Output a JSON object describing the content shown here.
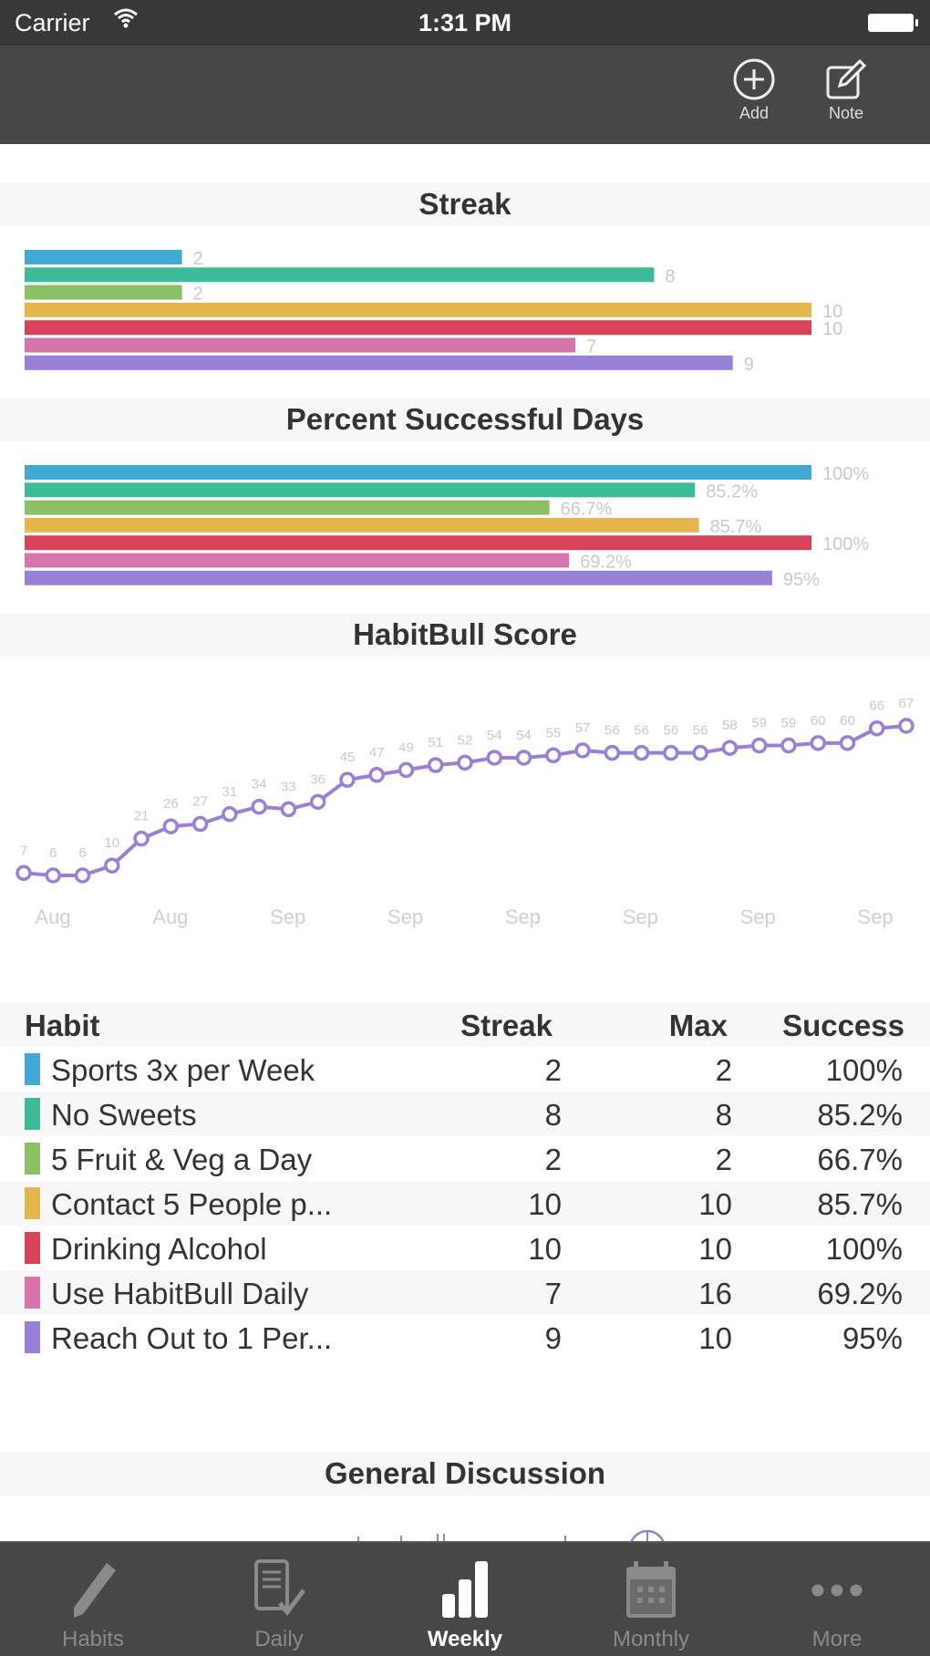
{
  "status_bar": {
    "carrier": "Carrier",
    "time": "1:31 PM"
  },
  "nav_bar": {
    "add_label": "Add",
    "note_label": "Note"
  },
  "colors": {
    "habit_colors": [
      "#41a9d4",
      "#3bbb98",
      "#8cc065",
      "#e6b64e",
      "#d8435a",
      "#d774aa",
      "#9a7fd6"
    ],
    "score_line": "#9a7fd6",
    "header_band": "#f7f7f7",
    "bar_chrome": "#474747"
  },
  "sections": {
    "streak_title": "Streak",
    "percent_title": "Percent Successful Days",
    "score_title": "HabitBull Score",
    "discussion_title": "General Discussion"
  },
  "chart_data": [
    {
      "type": "bar",
      "orientation": "horizontal",
      "title": "Streak",
      "categories": [
        "Sports 3x per Week",
        "No Sweets",
        "5 Fruit & Veg a Day",
        "Contact 5 People p...",
        "Drinking Alcohol",
        "Use HabitBull Daily",
        "Reach Out to 1 Per..."
      ],
      "values": [
        2,
        8,
        2,
        10,
        10,
        7,
        9
      ],
      "value_labels": [
        "2",
        "8",
        "2",
        "10",
        "10",
        "7",
        "9"
      ],
      "xlim": [
        0,
        10
      ]
    },
    {
      "type": "bar",
      "orientation": "horizontal",
      "title": "Percent Successful Days",
      "categories": [
        "Sports 3x per Week",
        "No Sweets",
        "5 Fruit & Veg a Day",
        "Contact 5 People p...",
        "Drinking Alcohol",
        "Use HabitBull Daily",
        "Reach Out to 1 Per..."
      ],
      "values": [
        100,
        85.2,
        66.7,
        85.7,
        100,
        69.2,
        95
      ],
      "value_labels": [
        "100%",
        "85.2%",
        "66.7%",
        "85.7%",
        "100%",
        "69.2%",
        "95%"
      ],
      "xlim": [
        0,
        100
      ]
    },
    {
      "type": "line",
      "title": "HabitBull Score",
      "series": [
        {
          "name": "HabitBull Score",
          "values": [
            7,
            6,
            6,
            10,
            21,
            26,
            27,
            31,
            34,
            33,
            36,
            45,
            47,
            49,
            51,
            52,
            54,
            54,
            55,
            57,
            56,
            56,
            56,
            56,
            58,
            59,
            59,
            60,
            60,
            66,
            67
          ]
        }
      ],
      "x_tick_labels": [
        "Aug",
        "Aug",
        "Sep",
        "Sep",
        "Sep",
        "Sep",
        "Sep",
        "Sep"
      ],
      "ylim": [
        6,
        67
      ],
      "grid": false,
      "legend": "none"
    }
  ],
  "table": {
    "headers": {
      "habit": "Habit",
      "streak": "Streak",
      "max": "Max",
      "success": "Success"
    },
    "rows": [
      {
        "habit": "Sports 3x per Week",
        "streak": "2",
        "max": "2",
        "success": "100%"
      },
      {
        "habit": "No Sweets",
        "streak": "8",
        "max": "8",
        "success": "85.2%"
      },
      {
        "habit": "5 Fruit & Veg a Day",
        "streak": "2",
        "max": "2",
        "success": "66.7%"
      },
      {
        "habit": "Contact 5 People p...",
        "streak": "10",
        "max": "10",
        "success": "85.7%"
      },
      {
        "habit": "Drinking Alcohol",
        "streak": "10",
        "max": "10",
        "success": "100%"
      },
      {
        "habit": "Use HabitBull Daily",
        "streak": "7",
        "max": "16",
        "success": "69.2%"
      },
      {
        "habit": "Reach Out to 1 Per...",
        "streak": "9",
        "max": "10",
        "success": "95%"
      }
    ]
  },
  "tab_bar": {
    "tabs": [
      {
        "label": "Habits",
        "icon": "pencil-icon",
        "active": false
      },
      {
        "label": "Daily",
        "icon": "checklist-icon",
        "active": false
      },
      {
        "label": "Weekly",
        "icon": "bar-chart-icon",
        "active": true
      },
      {
        "label": "Monthly",
        "icon": "calendar-icon",
        "active": false
      },
      {
        "label": "More",
        "icon": "more-icon",
        "active": false
      }
    ]
  }
}
